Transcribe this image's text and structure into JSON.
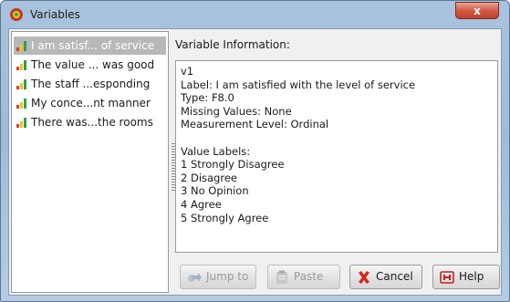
{
  "window": {
    "title": "Variables",
    "close_label": "x"
  },
  "variables": [
    {
      "label": "I am satisf... of service",
      "selected": true
    },
    {
      "label": "The value ... was good",
      "selected": false
    },
    {
      "label": "The staff ...esponding",
      "selected": false
    },
    {
      "label": "My conce...nt manner",
      "selected": false
    },
    {
      "label": "There was...the rooms",
      "selected": false
    }
  ],
  "info": {
    "heading": "Variable Information:",
    "lines": [
      "v1",
      "Label: I am satisfied with the level of service",
      "Type: F8.0",
      "Missing Values: None",
      "Measurement Level: Ordinal",
      "",
      "Value Labels:",
      "1 Strongly Disagree",
      "2 Disagree",
      "3 No Opinion",
      "4 Agree",
      "5 Strongly Agree"
    ]
  },
  "buttons": {
    "jump_to": "Jump to",
    "paste": "Paste",
    "cancel": "Cancel",
    "help": "Help"
  },
  "icons": {
    "app": "spss-app-icon",
    "ordinal": "ordinal-variable-icon",
    "jump_to": "jump-arrow-icon",
    "paste": "paste-icon",
    "cancel": "red-x-icon",
    "help": "help-icon"
  },
  "colors": {
    "bar_red": "#e33b2a",
    "bar_yellow": "#f2c21b",
    "bar_green": "#2fa04a",
    "cancel_red": "#d12a1c",
    "help_red": "#c8201a"
  }
}
